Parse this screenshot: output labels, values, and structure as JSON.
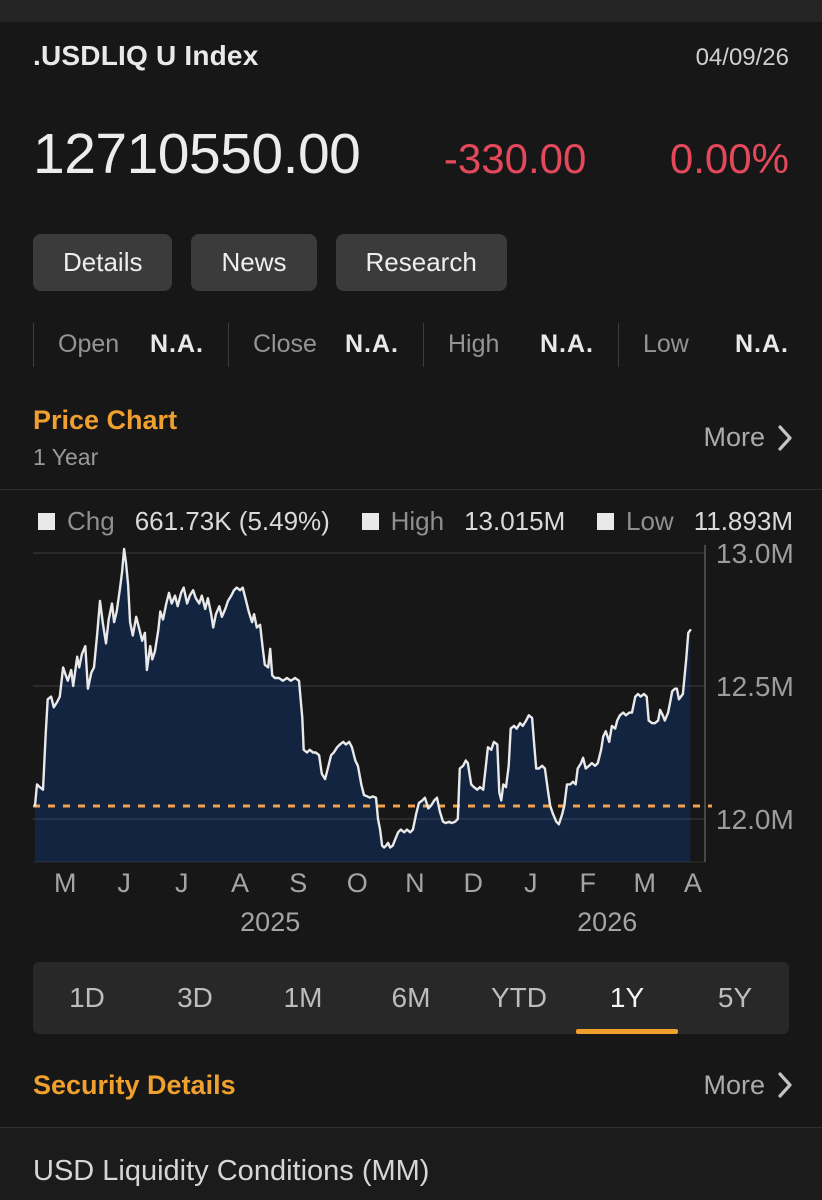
{
  "header": {
    "title": ".USDLIQ U Index",
    "date": "04/09/26"
  },
  "quote": {
    "price": "12710550.00",
    "change": "-330.00",
    "change_pct": "0.00%"
  },
  "action_buttons": [
    "Details",
    "News",
    "Research"
  ],
  "stats": [
    {
      "label": "Open",
      "value": "N.A."
    },
    {
      "label": "Close",
      "value": "N.A."
    },
    {
      "label": "High",
      "value": "N.A."
    },
    {
      "label": "Low",
      "value": "N.A."
    }
  ],
  "price_chart_section": {
    "title": "Price Chart",
    "subtitle": "1 Year",
    "more_label": "More"
  },
  "chart_legend": [
    {
      "label": "Chg",
      "value": "661.73K (5.49%)"
    },
    {
      "label": "High",
      "value": "13.015M"
    },
    {
      "label": "Low",
      "value": "11.893M"
    }
  ],
  "range_selector": {
    "options": [
      "1D",
      "3D",
      "1M",
      "6M",
      "YTD",
      "1Y",
      "5Y"
    ],
    "active": "1Y"
  },
  "security_details_section": {
    "title": "Security Details",
    "more_label": "More"
  },
  "footer": {
    "description": "USD Liquidity Conditions (MM)"
  },
  "colors": {
    "accent_orange": "#efa02f",
    "negative_red": "#e4495b",
    "underline_orange": "#f09e2c"
  },
  "chart_data": {
    "type": "area",
    "title": "Price Chart",
    "period": "1 Year",
    "x_axis_note": "pos = percent of plot width, spanning Apr 2025 to Apr 2026",
    "change": "661.73K (5.49%)",
    "high": 13.015,
    "low": 11.893,
    "last": 12.71055,
    "grid": true,
    "y_ticks": [
      {
        "label": "13.0M",
        "value": 13.0
      },
      {
        "label": "12.5M",
        "value": 12.5
      },
      {
        "label": "12.0M",
        "value": 12.0
      }
    ],
    "ylim": [
      11.838,
      13.05
    ],
    "reference_line": {
      "value": 12.0488,
      "style": "dotted",
      "meaning": "period start level"
    },
    "x_month_ticks": [
      {
        "label": "M",
        "pos": 4.5
      },
      {
        "label": "J",
        "pos": 13.3
      },
      {
        "label": "J",
        "pos": 21.9
      },
      {
        "label": "A",
        "pos": 30.6
      },
      {
        "label": "S",
        "pos": 39.3
      },
      {
        "label": "O",
        "pos": 48.1
      },
      {
        "label": "N",
        "pos": 56.7
      },
      {
        "label": "D",
        "pos": 65.4
      },
      {
        "label": "J",
        "pos": 74.0
      },
      {
        "label": "F",
        "pos": 82.5
      },
      {
        "label": "M",
        "pos": 91.0
      },
      {
        "label": "A",
        "pos": 98.2
      }
    ],
    "x_year_ticks": [
      {
        "label": "2025",
        "pos": 35.1
      },
      {
        "label": "2026",
        "pos": 85.4
      }
    ],
    "colors": {
      "fill": "#132440",
      "line": "#e9e9e9",
      "reference": "#f2a24d",
      "grid": "rgba(255,255,255,0.13)",
      "axis": "#5e5e5e",
      "tick_text": "#9c9c9c",
      "month_text": "#a5a5a5"
    },
    "series": [
      {
        "name": ".USDLIQ U Index (millions)",
        "points": [
          [
            0,
            12.05
          ],
          [
            0.3,
            12.13
          ],
          [
            0.7,
            12.12
          ],
          [
            1.2,
            12.11
          ],
          [
            1.6,
            12.32
          ],
          [
            1.9,
            12.45
          ],
          [
            2.4,
            12.46
          ],
          [
            2.8,
            12.42
          ],
          [
            3.3,
            12.44
          ],
          [
            3.7,
            12.46
          ],
          [
            4.2,
            12.57
          ],
          [
            4.6,
            12.54
          ],
          [
            4.9,
            12.52
          ],
          [
            5.4,
            12.56
          ],
          [
            5.7,
            12.5
          ],
          [
            6.3,
            12.61
          ],
          [
            6.6,
            12.57
          ],
          [
            7,
            12.62
          ],
          [
            7.5,
            12.65
          ],
          [
            7.9,
            12.49
          ],
          [
            8.4,
            12.55
          ],
          [
            8.8,
            12.57
          ],
          [
            9.3,
            12.7
          ],
          [
            9.7,
            12.82
          ],
          [
            10.1,
            12.74
          ],
          [
            10.6,
            12.66
          ],
          [
            11,
            12.75
          ],
          [
            11.5,
            12.81
          ],
          [
            11.8,
            12.74
          ],
          [
            12.2,
            12.78
          ],
          [
            12.7,
            12.87
          ],
          [
            13,
            12.93
          ],
          [
            13.3,
            13.015
          ],
          [
            13.6,
            12.96
          ],
          [
            13.9,
            12.88
          ],
          [
            14.2,
            12.74
          ],
          [
            14.6,
            12.69
          ],
          [
            15.1,
            12.76
          ],
          [
            15.5,
            12.72
          ],
          [
            16,
            12.67
          ],
          [
            16.4,
            12.7
          ],
          [
            16.7,
            12.56
          ],
          [
            17.2,
            12.65
          ],
          [
            17.5,
            12.6
          ],
          [
            17.9,
            12.63
          ],
          [
            18.4,
            12.71
          ],
          [
            18.7,
            12.78
          ],
          [
            19.1,
            12.75
          ],
          [
            19.6,
            12.81
          ],
          [
            20,
            12.85
          ],
          [
            20.4,
            12.81
          ],
          [
            20.9,
            12.84
          ],
          [
            21.3,
            12.8
          ],
          [
            21.8,
            12.85
          ],
          [
            22.2,
            12.87
          ],
          [
            22.7,
            12.81
          ],
          [
            23.1,
            12.84
          ],
          [
            23.6,
            12.86
          ],
          [
            24,
            12.83
          ],
          [
            24.5,
            12.81
          ],
          [
            24.9,
            12.84
          ],
          [
            25.4,
            12.79
          ],
          [
            25.8,
            12.83
          ],
          [
            26.3,
            12.77
          ],
          [
            26.6,
            12.72
          ],
          [
            27,
            12.77
          ],
          [
            27.5,
            12.8
          ],
          [
            27.9,
            12.76
          ],
          [
            28.4,
            12.79
          ],
          [
            28.8,
            12.82
          ],
          [
            29.3,
            12.84
          ],
          [
            29.7,
            12.86
          ],
          [
            30.1,
            12.87
          ],
          [
            30.6,
            12.86
          ],
          [
            31,
            12.87
          ],
          [
            31.5,
            12.82
          ],
          [
            31.9,
            12.78
          ],
          [
            32.4,
            12.74
          ],
          [
            32.7,
            12.77
          ],
          [
            33.1,
            12.72
          ],
          [
            33.6,
            12.73
          ],
          [
            34,
            12.64
          ],
          [
            34.3,
            12.58
          ],
          [
            34.8,
            12.57
          ],
          [
            35.1,
            12.64
          ],
          [
            35.4,
            12.54
          ],
          [
            35.8,
            12.53
          ],
          [
            36.4,
            12.53
          ],
          [
            37,
            12.52
          ],
          [
            37.6,
            12.53
          ],
          [
            38.2,
            12.52
          ],
          [
            38.8,
            12.53
          ],
          [
            39.4,
            12.52
          ],
          [
            39.9,
            12.38
          ],
          [
            40.1,
            12.26
          ],
          [
            40.6,
            12.25
          ],
          [
            41,
            12.26
          ],
          [
            41.5,
            12.25
          ],
          [
            41.9,
            12.25
          ],
          [
            42.4,
            12.24
          ],
          [
            42.8,
            12.17
          ],
          [
            43.3,
            12.15
          ],
          [
            43.7,
            12.19
          ],
          [
            44.2,
            12.24
          ],
          [
            44.6,
            12.25
          ],
          [
            45.1,
            12.27
          ],
          [
            45.5,
            12.28
          ],
          [
            46,
            12.29
          ],
          [
            46.4,
            12.28
          ],
          [
            46.9,
            12.29
          ],
          [
            47.3,
            12.27
          ],
          [
            47.8,
            12.22
          ],
          [
            48.2,
            12.2
          ],
          [
            48.7,
            12.13
          ],
          [
            49.1,
            12.09
          ],
          [
            49.6,
            12.085
          ],
          [
            50,
            12.08
          ],
          [
            50.4,
            12.085
          ],
          [
            50.9,
            12.08
          ],
          [
            51.2,
            12
          ],
          [
            51.5,
            11.96
          ],
          [
            51.8,
            11.9
          ],
          [
            52.1,
            11.893
          ],
          [
            52.4,
            11.9
          ],
          [
            52.7,
            11.91
          ],
          [
            53,
            11.893
          ],
          [
            53.4,
            11.9
          ],
          [
            53.7,
            11.92
          ],
          [
            54.2,
            11.95
          ],
          [
            54.6,
            11.96
          ],
          [
            55.1,
            11.95
          ],
          [
            55.5,
            11.96
          ],
          [
            56,
            11.95
          ],
          [
            56.4,
            11.96
          ],
          [
            56.9,
            12.02
          ],
          [
            57.3,
            12.06
          ],
          [
            57.8,
            12.07
          ],
          [
            58.2,
            12.08
          ],
          [
            58.7,
            12.04
          ],
          [
            59.1,
            12.05
          ],
          [
            59.6,
            12.07
          ],
          [
            60,
            12.08
          ],
          [
            60.4,
            12.03
          ],
          [
            60.9,
            11.99
          ],
          [
            61.3,
            11.985
          ],
          [
            61.8,
            11.99
          ],
          [
            62.2,
            11.985
          ],
          [
            62.7,
            11.99
          ],
          [
            63.1,
            12
          ],
          [
            63.4,
            12.19
          ],
          [
            63.9,
            12.2
          ],
          [
            64.3,
            12.22
          ],
          [
            64.6,
            12.21
          ],
          [
            65.1,
            12.13
          ],
          [
            65.5,
            12.12
          ],
          [
            66,
            12.11
          ],
          [
            66.4,
            12.12
          ],
          [
            66.9,
            12.11
          ],
          [
            67.3,
            12.2
          ],
          [
            67.6,
            12.27
          ],
          [
            68.1,
            12.26
          ],
          [
            68.5,
            12.29
          ],
          [
            69,
            12.28
          ],
          [
            69.3,
            12.1
          ],
          [
            69.6,
            12.07
          ],
          [
            69.9,
            12.13
          ],
          [
            70.3,
            12.12
          ],
          [
            70.7,
            12.2
          ],
          [
            71,
            12.34
          ],
          [
            71.5,
            12.35
          ],
          [
            71.9,
            12.34
          ],
          [
            72.4,
            12.36
          ],
          [
            72.8,
            12.35
          ],
          [
            73.3,
            12.37
          ],
          [
            73.7,
            12.39
          ],
          [
            74.2,
            12.38
          ],
          [
            74.5,
            12.28
          ],
          [
            74.8,
            12.19
          ],
          [
            75.2,
            12.19
          ],
          [
            75.7,
            12.2
          ],
          [
            76.1,
            12.19
          ],
          [
            76.6,
            12.1
          ],
          [
            76.9,
            12.05
          ],
          [
            77.3,
            12.02
          ],
          [
            77.8,
            11.99
          ],
          [
            78.2,
            11.98
          ],
          [
            78.7,
            12.02
          ],
          [
            79,
            12.05
          ],
          [
            79.4,
            12.13
          ],
          [
            79.9,
            12.13
          ],
          [
            80.3,
            12.14
          ],
          [
            80.7,
            12.13
          ],
          [
            81,
            12.19
          ],
          [
            81.5,
            12.21
          ],
          [
            81.8,
            12.23
          ],
          [
            82.2,
            12.19
          ],
          [
            82.7,
            12.2
          ],
          [
            83.1,
            12.21
          ],
          [
            83.6,
            12.2
          ],
          [
            84,
            12.21
          ],
          [
            84.5,
            12.26
          ],
          [
            84.8,
            12.31
          ],
          [
            85.2,
            12.33
          ],
          [
            85.7,
            12.29
          ],
          [
            86.1,
            12.35
          ],
          [
            86.6,
            12.34
          ],
          [
            86.9,
            12.37
          ],
          [
            87.3,
            12.39
          ],
          [
            87.8,
            12.4
          ],
          [
            88.2,
            12.39
          ],
          [
            88.7,
            12.4
          ],
          [
            89.1,
            12.4
          ],
          [
            89.6,
            12.46
          ],
          [
            90,
            12.47
          ],
          [
            90.4,
            12.46
          ],
          [
            90.9,
            12.47
          ],
          [
            91.3,
            12.46
          ],
          [
            91.6,
            12.37
          ],
          [
            92.1,
            12.36
          ],
          [
            92.5,
            12.36
          ],
          [
            93,
            12.37
          ],
          [
            93.3,
            12.41
          ],
          [
            93.7,
            12.39
          ],
          [
            94,
            12.37
          ],
          [
            94.5,
            12.4
          ],
          [
            94.8,
            12.44
          ],
          [
            95.1,
            12.48
          ],
          [
            95.5,
            12.49
          ],
          [
            95.8,
            12.49
          ],
          [
            96.1,
            12.45
          ],
          [
            96.4,
            12.46
          ],
          [
            96.7,
            12.47
          ],
          [
            97.2,
            12.6
          ],
          [
            97.5,
            12.7
          ],
          [
            97.8,
            12.71
          ]
        ]
      }
    ]
  }
}
